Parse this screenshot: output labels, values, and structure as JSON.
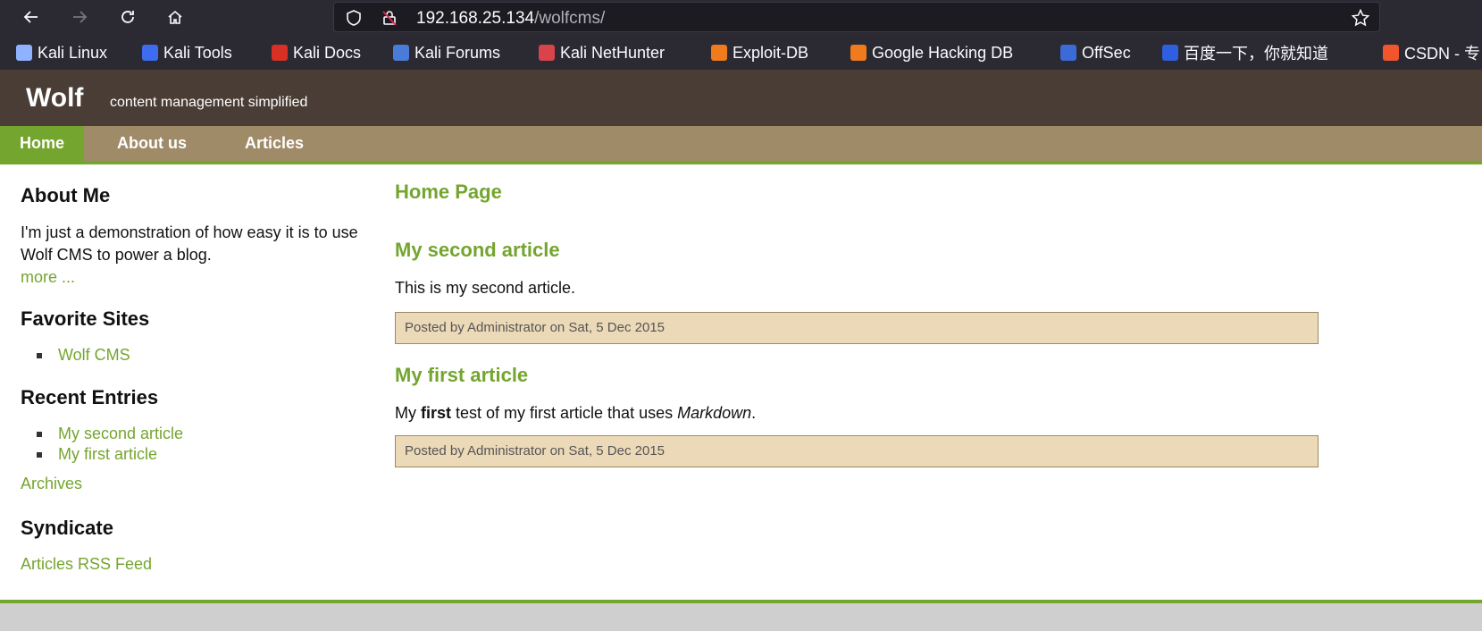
{
  "browser": {
    "url_host": "192.168.25.134",
    "url_path": "/wolfcms/",
    "bookmarks": [
      {
        "label": "Kali Linux",
        "icon": "kali-dragon-icon",
        "color": "#8fb3ff"
      },
      {
        "label": "Kali Tools",
        "icon": "kali-tools-icon",
        "color": "#3d6cf0"
      },
      {
        "label": "Kali Docs",
        "icon": "kali-docs-icon",
        "color": "#d93025"
      },
      {
        "label": "Kali Forums",
        "icon": "kali-forums-icon",
        "color": "#4a7bd8"
      },
      {
        "label": "Kali NetHunter",
        "icon": "nethunter-icon",
        "color": "#d9434c"
      },
      {
        "label": "Exploit-DB",
        "icon": "exploit-db-icon",
        "color": "#f07b1c"
      },
      {
        "label": "Google Hacking DB",
        "icon": "ghdb-icon",
        "color": "#f07b1c"
      },
      {
        "label": "OffSec",
        "icon": "offsec-icon",
        "color": "#3a6bd6"
      },
      {
        "label": "百度一下，你就知道",
        "icon": "baidu-icon",
        "color": "#2f5fe0"
      },
      {
        "label": "CSDN - 专",
        "icon": "csdn-icon",
        "color": "#f2552c"
      }
    ]
  },
  "site": {
    "logo": "Wolf",
    "slogan": "content management simplified",
    "nav": [
      "Home",
      "About us",
      "Articles"
    ]
  },
  "sidebar": {
    "about_title": "About Me",
    "about_text": "I'm just a demonstration of how easy it is to use Wolf CMS to power a blog.",
    "about_more": "more ...",
    "favorites_title": "Favorite Sites",
    "favorites": [
      "Wolf CMS"
    ],
    "recent_title": "Recent Entries",
    "recent": [
      "My second article",
      "My first article"
    ],
    "archives": "Archives",
    "syndicate_title": "Syndicate",
    "rss": "Articles RSS Feed"
  },
  "content": {
    "page_title": "Home Page",
    "articles": [
      {
        "title": "My second article",
        "body": "This is my second article.",
        "meta": "Posted by Administrator on Sat, 5 Dec 2015"
      },
      {
        "title": "My first article",
        "body_pre": "My ",
        "body_bold": "first",
        "body_mid": " test of my first article that uses ",
        "body_italic": "Markdown",
        "body_post": ".",
        "meta": "Posted by Administrator on Sat, 5 Dec 2015"
      }
    ]
  },
  "colors": {
    "accent": "#74a52e",
    "header_bg": "#4a3d36",
    "nav_bg": "#a08b69",
    "meta_bg": "#ecd9b8"
  }
}
